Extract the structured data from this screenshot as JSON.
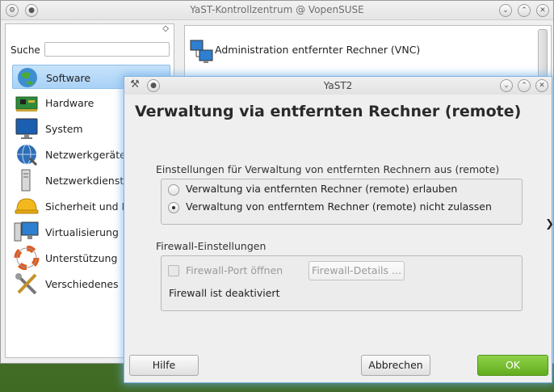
{
  "control_center": {
    "title": "YaST-Kontrollzentrum @ VopenSUSE",
    "search_label": "Suche",
    "search_value": "",
    "categories": [
      {
        "label": "Software",
        "icon": "software-globe-icon",
        "selected": true
      },
      {
        "label": "Hardware",
        "icon": "hardware-board-icon"
      },
      {
        "label": "System",
        "icon": "monitor-icon"
      },
      {
        "label": "Netzwerkgeräte",
        "icon": "network-globe-icon"
      },
      {
        "label": "Netzwerkdienste",
        "icon": "network-server-icon"
      },
      {
        "label": "Sicherheit und B",
        "icon": "security-helmet-icon"
      },
      {
        "label": "Virtualisierung",
        "icon": "virtual-monitor-icon"
      },
      {
        "label": "Unterstützung",
        "icon": "lifebuoy-icon"
      },
      {
        "label": "Verschiedenes",
        "icon": "tools-icon"
      }
    ],
    "modules": [
      {
        "label": "Administration entfernter Rechner (VNC)",
        "icon": "remote-computers-icon"
      }
    ]
  },
  "dialog": {
    "title": "YaST2",
    "heading": "Verwaltung via entfernten Rechner (remote)",
    "settings_group": {
      "title": "Einstellungen für Verwaltung von entfernten Rechnern aus (remote)",
      "option_allow": "Verwaltung via entfernten Rechner (remote) erlauben",
      "option_deny": "Verwaltung von entferntem Rechner (remote) nicht zulassen",
      "selected": "deny"
    },
    "firewall_group": {
      "title": "Firewall-Einstellungen",
      "open_port_label": "Firewall-Port öffnen",
      "open_port_checked": false,
      "details_button": "Firewall-Details ...",
      "status_text": "Firewall ist deaktiviert"
    },
    "buttons": {
      "help": "Hilfe",
      "cancel": "Abbrechen",
      "ok": "OK"
    }
  },
  "colors": {
    "ok_button": "#6ab526",
    "selection": "#b8daf8",
    "dialog_glow": "#7fb2e0"
  }
}
